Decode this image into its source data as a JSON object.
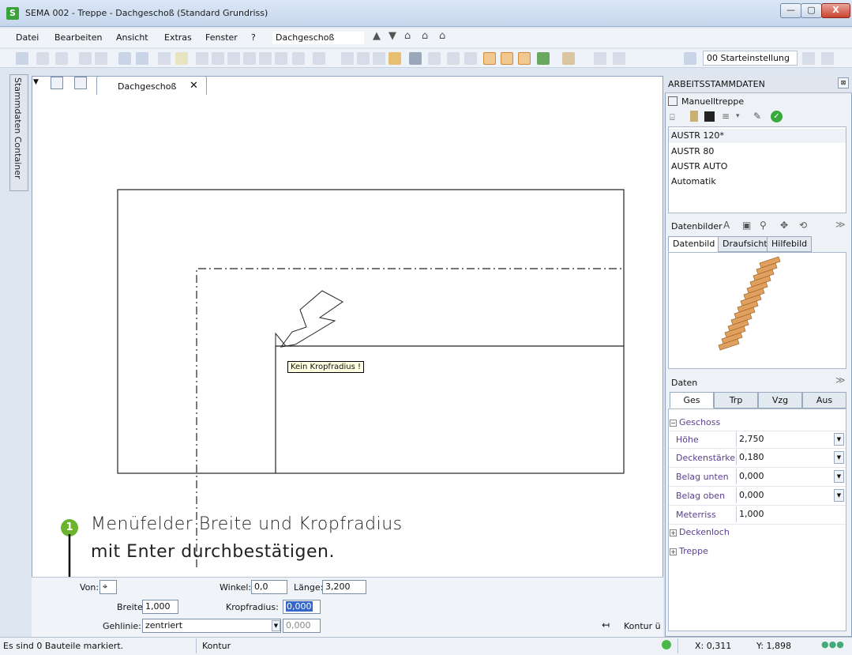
{
  "window": {
    "title": "SEMA  002 - Treppe  - Dachgeschoß (Standard Grundriss)",
    "logo": "S",
    "buttons": {
      "minimize": "—",
      "maximize": "▢",
      "close": "X"
    }
  },
  "menu": {
    "items": [
      "Datei",
      "Bearbeiten",
      "Ansicht",
      "Extras",
      "Fenster",
      "?"
    ],
    "floor_select": "Dachgeschoß"
  },
  "toolbar": {
    "start_select": "00 Starteinstellung"
  },
  "side_tab": {
    "label": "Stammdaten Container"
  },
  "document_tab": {
    "label": "Dachgeschoß",
    "close": "✕"
  },
  "drawing": {
    "tooltip": "Kein Kropfradius !"
  },
  "annotation": {
    "number": "1",
    "line1": "Menüfelder Breite und Kropfradius",
    "line2": "mit Enter durchbestätigen."
  },
  "input_area": {
    "von_label": "Von:",
    "winkel_label": "Winkel:",
    "winkel_value": "0,0",
    "laenge_label": "Länge:",
    "laenge_value": "3,200",
    "breite_label": "Breite:",
    "breite_value": "1,000",
    "kropf_label": "Kropfradius:",
    "kropf_value": "0,000",
    "gehlinie_label": "Gehlinie:",
    "gehlinie_value": "zentriert",
    "gehlinie_offset": "0,000",
    "kontur_label": "Kontur ü"
  },
  "statusbar": {
    "message": "Es sind 0 Bauteile markiert.",
    "mode": "Kontur",
    "x_label": "X: 0,311",
    "y_label": "Y: 1,898"
  },
  "right_panel": {
    "title": "ARBEITSSTAMMDATEN",
    "close": "⊠",
    "stair_header": "Manuelltreppe",
    "list": [
      "AUSTR 120*",
      "AUSTR 80",
      "AUSTR AUTO",
      "Automatik"
    ],
    "datenbilder_label": "Datenbilder",
    "image_tabs": [
      "Datenbild",
      "Draufsicht",
      "Hilfebild"
    ],
    "daten_label": "Daten",
    "data_tabs": [
      "Ges",
      "Trp",
      "Vzg",
      "Aus"
    ],
    "groups": {
      "geschoss": "Geschoss",
      "deckenloch": "Deckenloch",
      "treppe": "Treppe"
    },
    "properties": [
      {
        "label": "Höhe",
        "value": "2,750"
      },
      {
        "label": "Deckenstärke",
        "value": "0,180"
      },
      {
        "label": "Belag unten",
        "value": "0,000"
      },
      {
        "label": "Belag oben",
        "value": "0,000"
      },
      {
        "label": "Meterriss",
        "value": "1,000"
      }
    ]
  },
  "colors": {
    "accent_green": "#6ab42f",
    "highlight_blue": "#3366cc",
    "step_orange": "#e0a060"
  }
}
